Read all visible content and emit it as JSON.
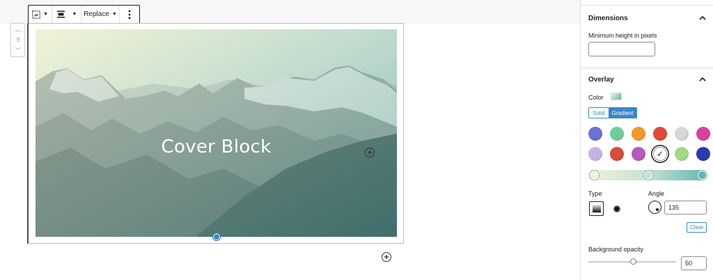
{
  "toolbar": {
    "replace_label": "Replace",
    "icons": [
      "cover-block-icon",
      "align-icon",
      "more-options-icon"
    ]
  },
  "mover": {
    "icons": [
      "chevron-up-icon",
      "drag-handle-icon",
      "chevron-down-icon"
    ]
  },
  "cover": {
    "title": "Cover Block"
  },
  "sidebar": {
    "dimensions": {
      "heading": "Dimensions",
      "min_height_label": "Minimum height in pixels",
      "min_height_value": ""
    },
    "overlay": {
      "heading": "Overlay",
      "color_label": "Color",
      "tabs": [
        "Solid",
        "Gradient"
      ],
      "selected_tab": "Gradient",
      "swatches": [
        "#6a72d6",
        "#6ccf9b",
        "#f3962d",
        "#de4b39",
        "#d5d7db",
        "#d8429a",
        "#c7b2e6",
        "#d84c3a",
        "#b35bbf",
        "#ffffff",
        "#a2d986",
        "#2a3bb0"
      ],
      "selected_swatch_index": 9,
      "type_label": "Type",
      "angle_label": "Angle",
      "angle_value": "135",
      "clear_label": "Clear",
      "opacity_label": "Background opacity",
      "opacity_value": "50"
    }
  },
  "colors": {
    "accent": "#3a87c8",
    "gradient_start": "#eef3d6",
    "gradient_mid": "#c8e2d3",
    "gradient_end": "#62b5b4"
  }
}
